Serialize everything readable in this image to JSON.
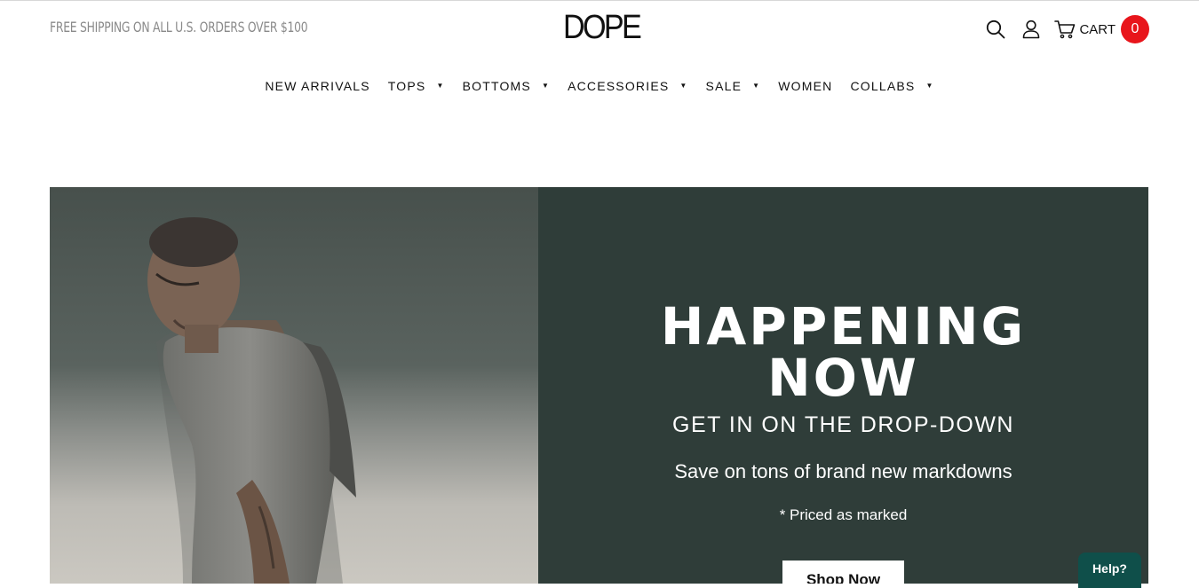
{
  "header": {
    "promo_text": "FREE SHIPPING ON ALL U.S. ORDERS OVER $100",
    "logo_text": "DOPE",
    "icons": [
      "search-icon",
      "account-icon",
      "cart-icon"
    ],
    "cart_label": "CART",
    "cart_count": "0",
    "cart_badge_color": "#e8151b"
  },
  "nav": {
    "items": [
      {
        "label": "NEW ARRIVALS",
        "dropdown": false
      },
      {
        "label": "TOPS",
        "dropdown": true
      },
      {
        "label": "BOTTOMS",
        "dropdown": true
      },
      {
        "label": "ACCESSORIES",
        "dropdown": true
      },
      {
        "label": "SALE",
        "dropdown": true
      },
      {
        "label": "WOMEN",
        "dropdown": false
      },
      {
        "label": "COLLABS",
        "dropdown": true
      }
    ],
    "caret_glyph": "▼"
  },
  "hero": {
    "headline_line1": "HAPPENING",
    "headline_line2": "NOW",
    "subhead": "GET IN ON THE DROP-DOWN",
    "tagline": "Save on tons of brand new markdowns",
    "note": "* Priced as marked",
    "cta_label": "Shop Now",
    "panel_color": "#2f3d39"
  },
  "help_widget": {
    "label": "Help?",
    "color": "#0f4f4a"
  }
}
